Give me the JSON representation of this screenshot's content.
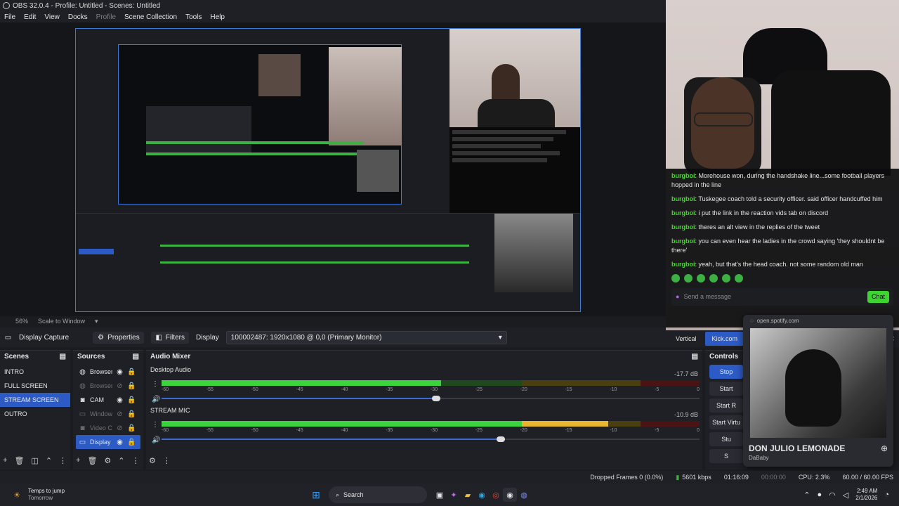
{
  "window": {
    "title": "OBS 32.0.4 - Profile: Untitled - Scenes: Untitled"
  },
  "menu": [
    "File",
    "Edit",
    "View",
    "Docks",
    "Profile",
    "Scene Collection",
    "Tools",
    "Help"
  ],
  "zoom": {
    "level": "56%",
    "mode": "Scale to Window"
  },
  "context": {
    "source_label": "Display Capture",
    "properties": "Properties",
    "filters": "Filters",
    "display_label": "Display",
    "display_value": "100002487: 1920x1080 @ 0,0 (Primary Monitor)"
  },
  "scenes": {
    "title": "Scenes",
    "items": [
      "INTRO",
      "FULL SCREEN",
      "STREAM SCREEN",
      "OUTRO"
    ],
    "selected": "STREAM SCREEN"
  },
  "sources": {
    "title": "Sources",
    "items": [
      {
        "label": "Browser",
        "icon": "globe-icon",
        "visible": true
      },
      {
        "label": "Browser",
        "icon": "globe-icon",
        "visible": false
      },
      {
        "label": "CAM",
        "icon": "camera-icon",
        "visible": true
      },
      {
        "label": "Window",
        "icon": "window-icon",
        "visible": false
      },
      {
        "label": "Video C",
        "icon": "camera-icon",
        "visible": false
      },
      {
        "label": "Display",
        "icon": "monitor-icon",
        "visible": true
      }
    ]
  },
  "mixer": {
    "title": "Audio Mixer",
    "tracks": [
      {
        "name": "Desktop Audio",
        "db": "-17.7 dB",
        "level": 0.52,
        "fader": 0.51
      },
      {
        "name": "STREAM MIC",
        "db": "-10.9 dB",
        "level": 0.83,
        "fader": 0.63
      }
    ],
    "scale": [
      "-60",
      "-55",
      "-50",
      "-45",
      "-40",
      "-35",
      "-30",
      "-25",
      "-20",
      "-15",
      "-10",
      "-5",
      "0"
    ]
  },
  "controls": {
    "title": "Controls",
    "buttons": [
      "Stop",
      "Start",
      "Start R",
      "Start Virtu",
      "Stu",
      "S"
    ]
  },
  "status": {
    "dropped": "Dropped Frames 0 (0.0%)",
    "kbps": "5601 kbps",
    "stream_time": "01:16:09",
    "rec_time": "00:00:00",
    "cpu": "CPU: 2.3%",
    "fps": "60.00 / 60.00 FPS"
  },
  "taskbar": {
    "weather_title": "Temps to jump",
    "weather_sub": "Tomorrow",
    "search": "Search",
    "time": "2:49 AM",
    "date": "2/1/2026"
  },
  "chat": {
    "messages": [
      {
        "user": "burgboi",
        "text": "Morehouse won, during the handshake line...some football players hopped in the line"
      },
      {
        "user": "burgboi",
        "text": "Tuskegee coach told a security officer. said officer handcuffed him"
      },
      {
        "user": "burgboi",
        "text": "i put the link in the reaction vids tab on discord"
      },
      {
        "user": "burgboi",
        "text": "theres an alt view in the replies of the tweet"
      },
      {
        "user": "burgboi",
        "text": "you can even hear the ladies in the crowd saying 'they shouldnt be there'"
      },
      {
        "user": "burgboi",
        "text": "yeah, but that's the head coach. not some random old man"
      }
    ],
    "input_placeholder": "Send a message",
    "chat_button": "Chat"
  },
  "stream_tabs": [
    "Vertical",
    "Kick.com"
  ],
  "spotify": {
    "url": "open.spotify.com",
    "track": "DON JULIO LEMONADE",
    "artist": "DaBaby"
  }
}
